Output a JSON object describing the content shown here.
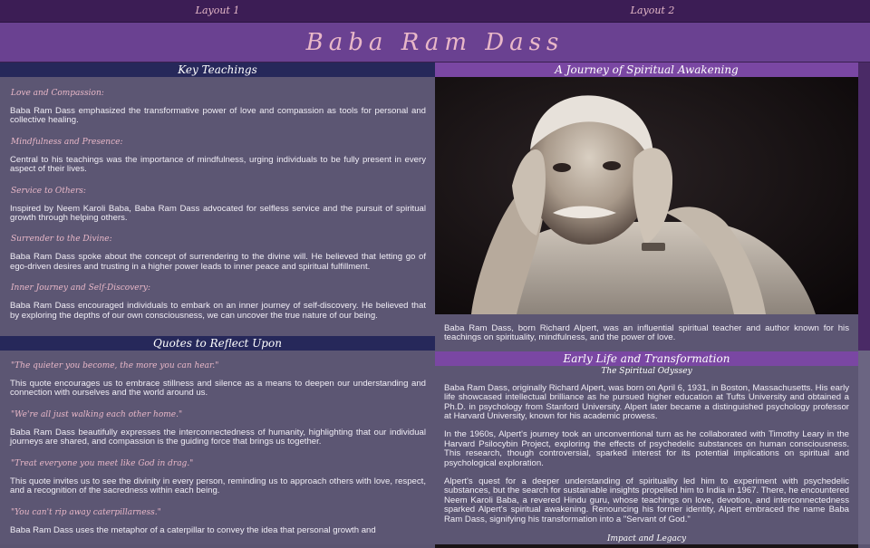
{
  "nav": {
    "layout1": "Layout 1",
    "layout2": "Layout 2"
  },
  "site": {
    "title": "Baba Ram Dass"
  },
  "teachings": {
    "heading": "Key Teachings",
    "items": [
      {
        "title": "Love and Compassion:",
        "text": "Baba Ram Dass emphasized the transformative power of love and compassion as tools for personal and collective healing."
      },
      {
        "title": "Mindfulness and Presence:",
        "text": "Central to his teachings was the importance of mindfulness, urging individuals to be fully present in every aspect of their lives."
      },
      {
        "title": "Service to Others:",
        "text": "Inspired by Neem Karoli Baba, Baba Ram Dass advocated for selfless service and the pursuit of spiritual growth through helping others."
      },
      {
        "title": "Surrender to the Divine:",
        "text": "Baba Ram Dass spoke about the concept of surrendering to the divine will. He believed that letting go of ego-driven desires and trusting in a higher power leads to inner peace and spiritual fulfillment."
      },
      {
        "title": "Inner Journey and Self-Discovery:",
        "text": "Baba Ram Dass encouraged individuals to embark on an inner journey of self-discovery. He believed that by exploring the depths of our own consciousness, we can uncover the true nature of our being."
      }
    ]
  },
  "quotes": {
    "heading": "Quotes to Reflect Upon",
    "items": [
      {
        "quote": "\"The quieter you become, the more you can hear.\"",
        "text": "This quote encourages us to embrace stillness and silence as a means to deepen our understanding and connection with ourselves and the world around us."
      },
      {
        "quote": "\"We're all just walking each other home.\"",
        "text": "Baba Ram Dass beautifully expresses the interconnectedness of humanity, highlighting that our individual journeys are shared, and compassion is the guiding force that brings us together."
      },
      {
        "quote": "\"Treat everyone you meet like God in drag.\"",
        "text": "This quote invites us to see the divinity in every person, reminding us to approach others with love, respect, and a recognition of the sacredness within each being."
      },
      {
        "quote": "\"You can't rip away caterpillarness.\"",
        "text": "Baba Ram Dass uses the metaphor of a caterpillar to convey the idea that personal growth and"
      }
    ]
  },
  "journey": {
    "heading": "A Journey of Spiritual Awakening",
    "intro": "Baba Ram Dass, born Richard Alpert, was an influential spiritual teacher and author known for his teachings on spirituality, mindfulness, and the power of love."
  },
  "early": {
    "heading": "Early Life and Transformation",
    "subheading": "The Spiritual Odyssey",
    "paragraphs": [
      "Baba Ram Dass, originally Richard Alpert, was born on April 6, 1931, in Boston, Massachusetts. His early life showcased intellectual brilliance as he pursued higher education at Tufts University and obtained a Ph.D. in psychology from Stanford University. Alpert later became a distinguished psychology professor at Harvard University, known for his academic prowess.",
      "In the 1960s, Alpert's journey took an unconventional turn as he collaborated with Timothy Leary in the Harvard Psilocybin Project, exploring the effects of psychedelic substances on human consciousness. This research, though controversial, sparked interest for its potential implications on spiritual and psychological exploration.",
      "Alpert's quest for a deeper understanding of spirituality led him to experiment with psychedelic substances, but the search for sustainable insights propelled him to India in 1967. There, he encountered Neem Karoli Baba, a revered Hindu guru, whose teachings on love, devotion, and interconnectedness sparked Alpert's spiritual awakening. Renouncing his former identity, Alpert embraced the name Baba Ram Dass, signifying his transformation into a \"Servant of God.\""
    ],
    "impact_heading": "Impact and Legacy"
  }
}
